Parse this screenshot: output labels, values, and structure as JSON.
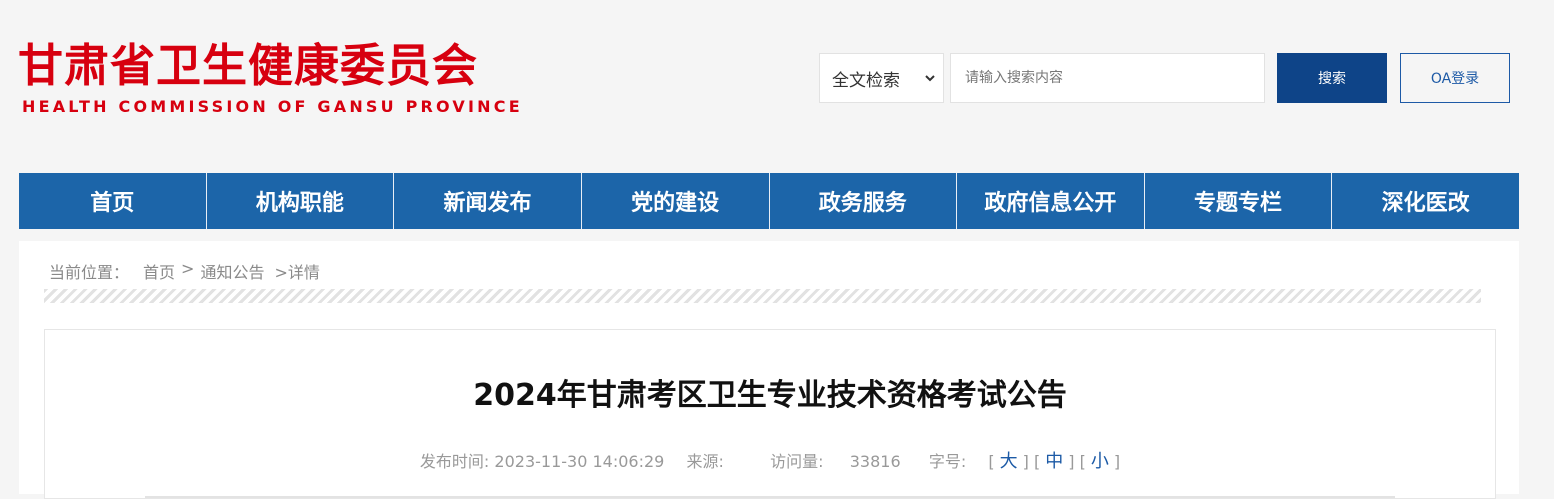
{
  "logo": {
    "cn": "甘肃省卫生健康委员会",
    "en": "HEALTH COMMISSION OF GANSU PROVINCE"
  },
  "search": {
    "scope": "全文检索",
    "placeholder": "请输入搜索内容",
    "button": "搜索",
    "oa": "OA登录"
  },
  "nav": [
    "首页",
    "机构职能",
    "新闻发布",
    "党的建设",
    "政务服务",
    "政府信息公开",
    "专题专栏",
    "深化医改"
  ],
  "breadcrumb": {
    "label": "当前位置：",
    "items": [
      "首页",
      ">",
      "通知公告",
      ">详情"
    ]
  },
  "article": {
    "title": "2024年甘肃考区卫生专业技术资格考试公告",
    "publish_label": "发布时间:",
    "publish_time": "2023-11-30 14:06:29",
    "source_label": "来源:",
    "visits_label": "访问量:",
    "visits": "33816",
    "font_label": "字号:",
    "font_sizes": [
      "大",
      "中",
      "小"
    ]
  },
  "colors": {
    "brand_red": "#d7000f",
    "nav_blue": "#1c65a9",
    "search_blue": "#0e4488"
  }
}
